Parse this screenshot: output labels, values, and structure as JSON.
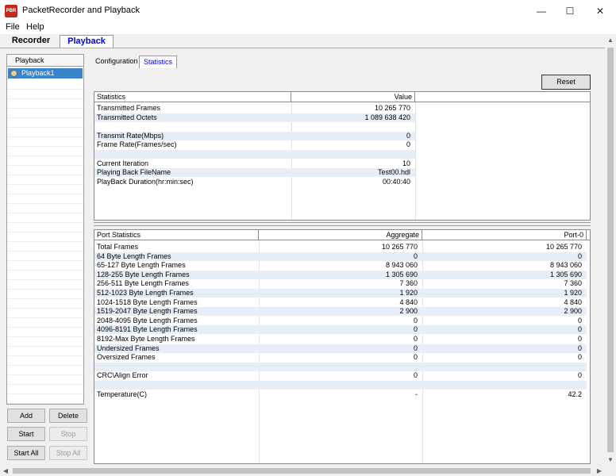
{
  "window": {
    "title": "PacketRecorder and Playback",
    "icon_text": "PBR"
  },
  "menu": [
    "File",
    "Help"
  ],
  "main_tabs": {
    "recorder": "Recorder",
    "playback": "Playback"
  },
  "left": {
    "header": "Playback",
    "items": [
      "Playback1"
    ],
    "buttons": {
      "add": "Add",
      "delete": "Delete",
      "start": "Start",
      "stop": "Stop",
      "start_all": "Start All",
      "stop_all": "Stop All"
    }
  },
  "sub_tabs": {
    "configuration": "Configuration",
    "statistics": "Statistics"
  },
  "reset_label": "Reset",
  "stats_table": {
    "columns": [
      "Statistics",
      "Value"
    ],
    "rows": [
      [
        "Transmitted Frames",
        "10 265 770"
      ],
      [
        "Transmitted Octets",
        "1 089 638 420"
      ],
      [
        "",
        ""
      ],
      [
        "Transmit Rate(Mbps)",
        "0"
      ],
      [
        "Frame Rate(Frames/sec)",
        "0"
      ],
      [
        "",
        ""
      ],
      [
        "Current Iteration",
        "10"
      ],
      [
        "Playing Back FileName",
        "Test00.hdl"
      ],
      [
        "PlayBack Duration(hr:min:sec)",
        "00:40:40"
      ]
    ]
  },
  "port_table": {
    "columns": [
      "Port Statistics",
      "Aggregate",
      "Port-0"
    ],
    "rows": [
      [
        "Total Frames",
        "10 265 770",
        "10 265 770"
      ],
      [
        "64 Byte Length Frames",
        "0",
        "0"
      ],
      [
        "65-127 Byte Length Frames",
        "8 943 060",
        "8 943 060"
      ],
      [
        "128-255 Byte Length Frames",
        "1 305 690",
        "1 305 690"
      ],
      [
        "256-511 Byte Length Frames",
        "7 360",
        "7 360"
      ],
      [
        "512-1023 Byte Length Frames",
        "1 920",
        "1 920"
      ],
      [
        "1024-1518 Byte Length Frames",
        "4 840",
        "4 840"
      ],
      [
        "1519-2047 Byte Length Frames",
        "2 900",
        "2 900"
      ],
      [
        "2048-4095 Byte Length Frames",
        "0",
        "0"
      ],
      [
        "4096-8191 Byte Length Frames",
        "0",
        "0"
      ],
      [
        "8192-Max Byte Length Frames",
        "0",
        "0"
      ],
      [
        "Undersized Frames",
        "0",
        "0"
      ],
      [
        "Oversized Frames",
        "0",
        "0"
      ],
      [
        "",
        "",
        ""
      ],
      [
        "CRC\\Align Error",
        "0",
        "0"
      ],
      [
        "",
        "",
        ""
      ],
      [
        "Temperature(C)",
        "-",
        "42.2"
      ]
    ]
  },
  "colors": {
    "selection": "#3a84cc",
    "active_tab_text": "#0000d0",
    "row_stripe": "#e7eef8"
  },
  "icons": [
    "app-icon",
    "minimize-icon",
    "maximize-icon",
    "close-icon",
    "playback-status-icon"
  ]
}
